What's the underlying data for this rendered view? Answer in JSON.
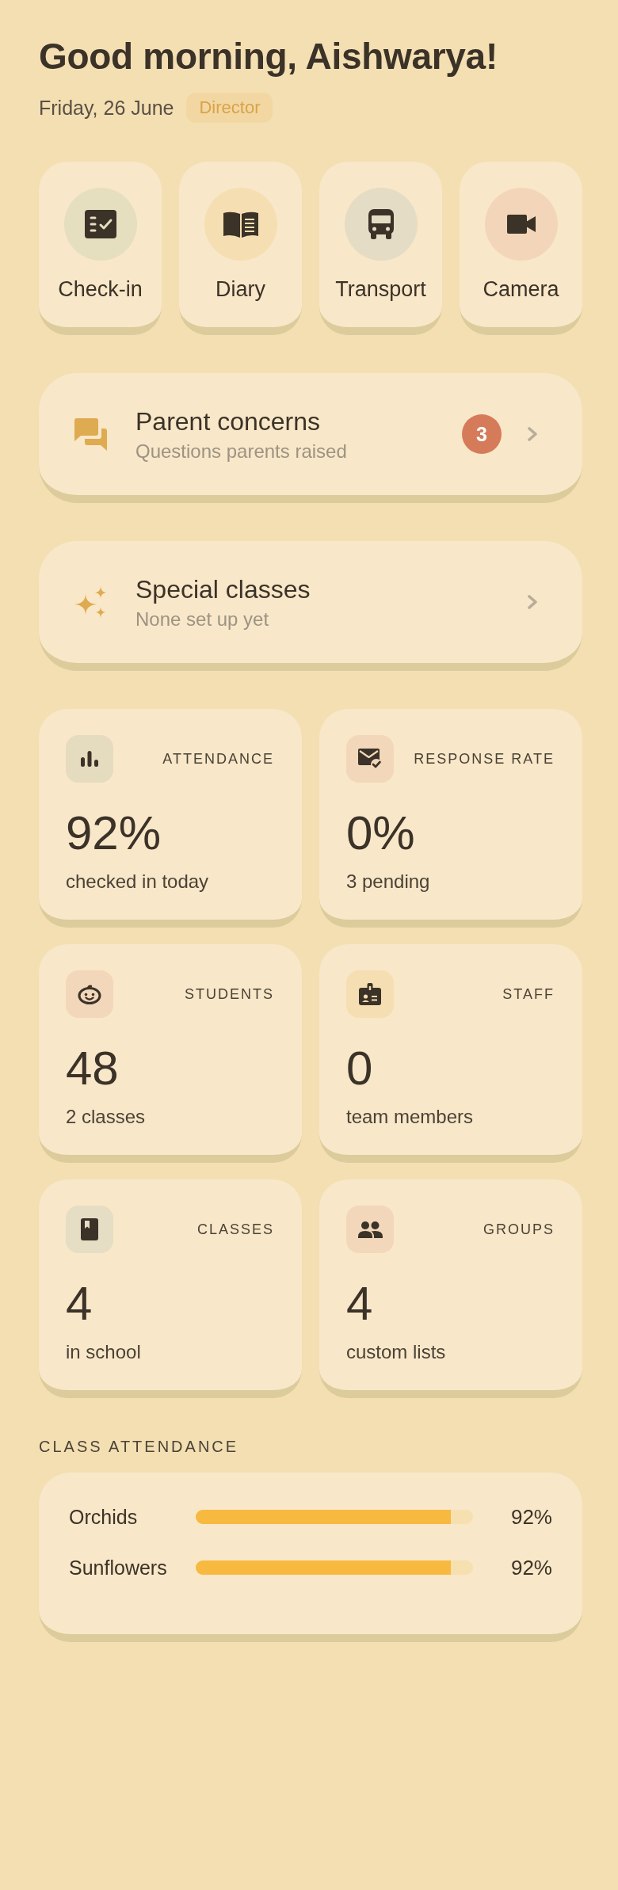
{
  "greeting": {
    "title": "Good morning, Aishwarya!",
    "date": "Friday, 26 June",
    "role": "Director"
  },
  "quick_actions": [
    {
      "label": "Check-in",
      "color": "#e6dfbf"
    },
    {
      "label": "Diary",
      "color": "#f5dfb2"
    },
    {
      "label": "Transport",
      "color": "#e5dcc5"
    },
    {
      "label": "Camera",
      "color": "#f3d6b9"
    }
  ],
  "nav_cards": [
    {
      "title": "Parent concerns",
      "subtitle": "Questions parents raised",
      "badge": "3"
    },
    {
      "title": "Special classes",
      "subtitle": "None set up yet"
    }
  ],
  "stats": [
    {
      "label": "ATTENDANCE",
      "value": "92%",
      "caption": "checked in today",
      "color": "#e5dcbf"
    },
    {
      "label": "RESPONSE RATE",
      "value": "0%",
      "caption": "3 pending",
      "color": "#f3d7ba"
    },
    {
      "label": "STUDENTS",
      "value": "48",
      "caption": "2 classes",
      "color": "#f3d7ba"
    },
    {
      "label": "STAFF",
      "value": "0",
      "caption": "team members",
      "color": "#f5deb2"
    },
    {
      "label": "CLASSES",
      "value": "4",
      "caption": "in school",
      "color": "#e6ddc5"
    },
    {
      "label": "GROUPS",
      "value": "4",
      "caption": "custom lists",
      "color": "#f3d7ba"
    }
  ],
  "class_attendance": {
    "title": "CLASS ATTENDANCE",
    "rows": [
      {
        "name": "Orchids",
        "level": 0.92,
        "reading": "92%"
      },
      {
        "name": "Sunflowers",
        "level": 0.92,
        "reading": "92%"
      }
    ]
  }
}
